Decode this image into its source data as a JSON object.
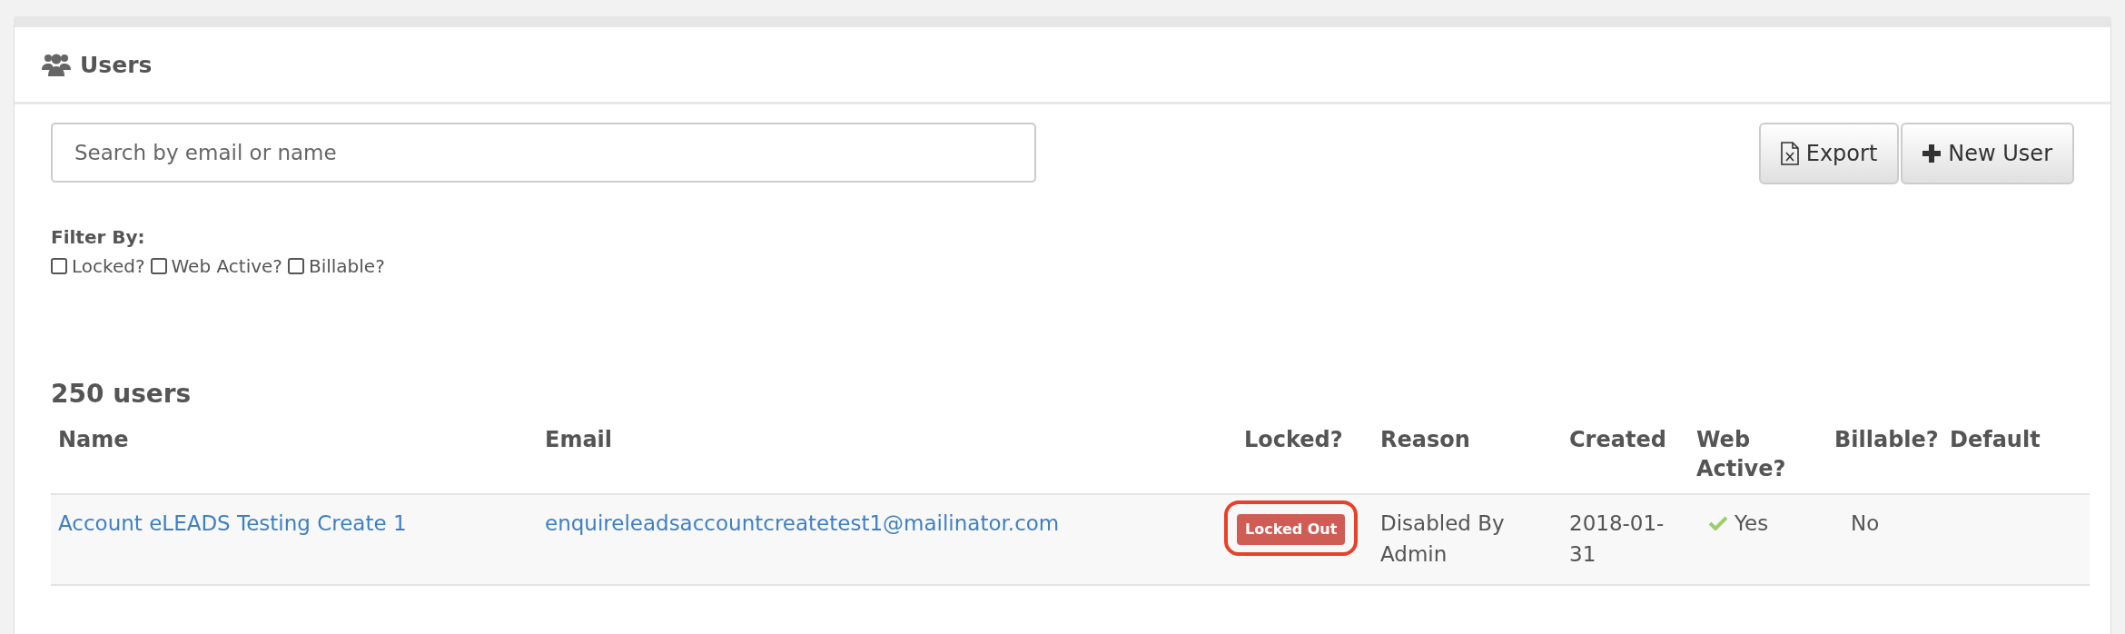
{
  "panel": {
    "title": "Users"
  },
  "search": {
    "placeholder": "Search by email or name"
  },
  "buttons": [
    {
      "kind": "export",
      "label": "Export"
    },
    {
      "kind": "add",
      "label": "New User"
    }
  ],
  "filter": {
    "label": "Filter By:",
    "options": [
      {
        "label": "Locked?",
        "checked": false
      },
      {
        "label": "Web Active?",
        "checked": false
      },
      {
        "label": "Billable?",
        "checked": false
      }
    ]
  },
  "count": "250 users",
  "table": {
    "columns": [
      "Name",
      "Email",
      "Locked?",
      "Reason",
      "Created",
      "Web Active?",
      "Billable?",
      "Default"
    ],
    "rows": [
      {
        "name": "Account eLEADS Testing Create 1",
        "email": "enquireleadsaccountcreatetest1@mailinator.com",
        "locked": "Locked Out",
        "locked_highlighted": true,
        "reason": "Disabled By Admin",
        "created": "2018-01-31",
        "web_active": "Yes",
        "web_active_checked": true,
        "billable": "No"
      }
    ]
  }
}
